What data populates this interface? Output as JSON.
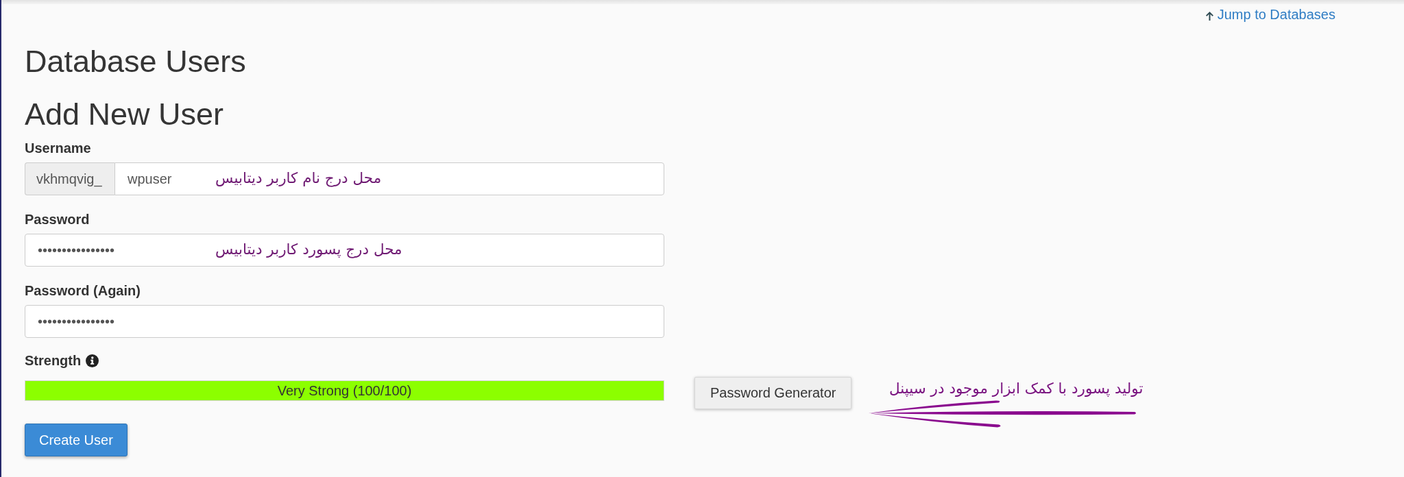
{
  "jump_link": {
    "label": "Jump to Databases"
  },
  "page_title": "Database Users",
  "section_title": "Add New User",
  "fields": [
    {
      "kind": "prefixed",
      "label": "Username",
      "prefix": "vkhmqvig_",
      "value": "wpuser",
      "note": "محل درج نام کاربر دیتابیس"
    },
    {
      "kind": "password",
      "label": "Password",
      "value": "••••••••••••••••",
      "note": "محل درج پسورد کاربر دیتابیس"
    },
    {
      "kind": "password",
      "label": "Password (Again)",
      "value": "••••••••••••••••"
    }
  ],
  "strength": {
    "label": "Strength",
    "level": 1,
    "reading": "Very Strong (100/100)"
  },
  "password_generator": {
    "label": "Password Generator",
    "note": "تولید پسورد با کمک ابزار موجود در سیپنل"
  },
  "create_button": {
    "label": "Create User"
  }
}
